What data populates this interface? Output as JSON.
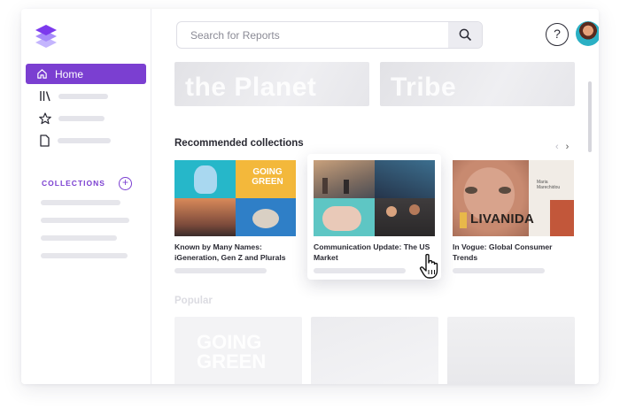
{
  "nav": {
    "home_label": "Home",
    "collections_label": "COLLECTIONS"
  },
  "search": {
    "placeholder": "Search for Reports"
  },
  "header": {
    "help_label": "?",
    "caret": "▾"
  },
  "banners": [
    "the Planet",
    "Tribe"
  ],
  "recommended": {
    "title": "Recommended collections",
    "arrows": [
      "‹",
      "›"
    ],
    "cards": [
      {
        "title": "Known by Many Names: iGeneration, Gen Z and Plurals",
        "art_text": "GOING GREEN"
      },
      {
        "title": "Communication Update: The US Market"
      },
      {
        "title": "In Vogue: Global Consumer Trends",
        "art_text": "LIVANIDA",
        "tag_text": "Maria Marechidou"
      }
    ]
  },
  "popular": {
    "title": "Popular",
    "ghost_text": "GOING GREEN"
  },
  "colors": {
    "accent": "#7b3fd1",
    "accent_light": "#a78bfa"
  }
}
